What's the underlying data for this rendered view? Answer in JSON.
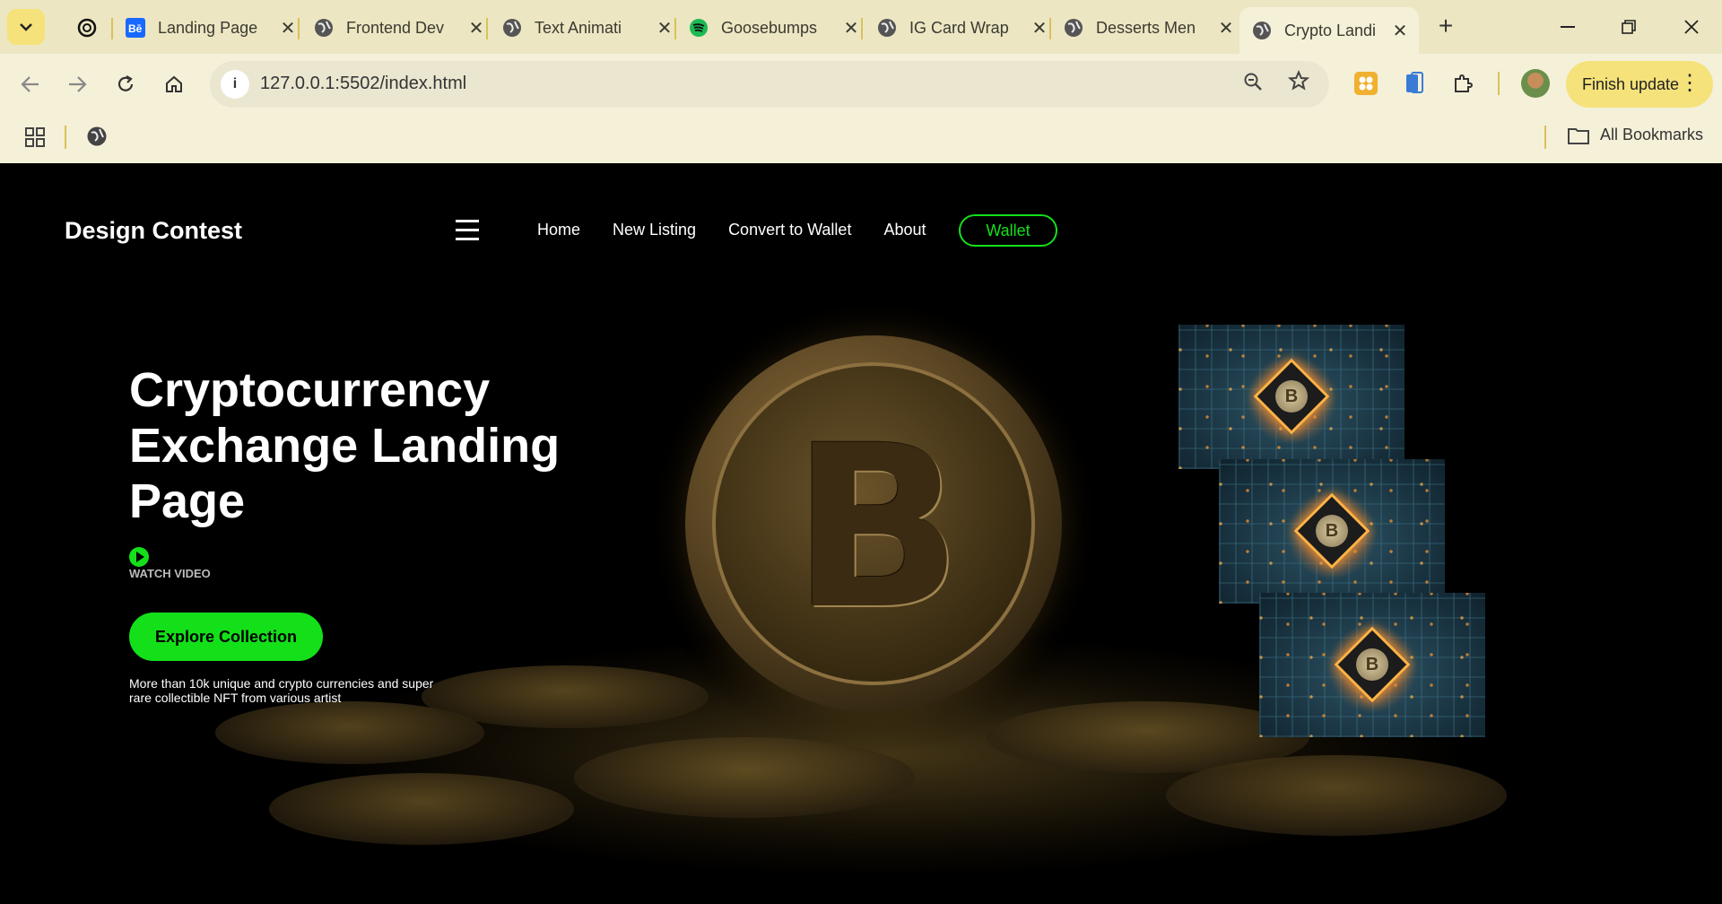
{
  "browser": {
    "tabs": [
      {
        "title": "",
        "icon": "chatgpt-icon"
      },
      {
        "title": "Landing Page",
        "icon": "behance-icon"
      },
      {
        "title": "Frontend Dev",
        "icon": "globe-icon"
      },
      {
        "title": "Text Animati",
        "icon": "globe-icon"
      },
      {
        "title": "Goosebumps",
        "icon": "spotify-icon"
      },
      {
        "title": "IG Card Wrap",
        "icon": "globe-icon"
      },
      {
        "title": "Desserts Men",
        "icon": "globe-icon"
      },
      {
        "title": "Crypto Landi",
        "icon": "globe-icon",
        "active": true
      }
    ],
    "url": "127.0.0.1:5502/index.html",
    "finish_update": "Finish update",
    "all_bookmarks": "All Bookmarks"
  },
  "site": {
    "brand": "Design Contest",
    "nav": {
      "home": "Home",
      "new_listing": "New Listing",
      "convert": "Convert to Wallet",
      "about": "About",
      "wallet": "Wallet"
    },
    "hero": {
      "title": "Cryptocurrency Exchange Landing Page",
      "watch_video": "WATCH VIDEO",
      "cta": "Explore Collection",
      "blurb": "More than 10k unique and crypto currencies and super rare collectible NFT from various artist"
    },
    "coin_symbol": "B",
    "card_symbol": "B"
  },
  "colors": {
    "accent_green": "#14e01a",
    "chrome_bg": "#f5f0d8",
    "tab_strip": "#ece6c2",
    "update_pill": "#f5e27a"
  }
}
